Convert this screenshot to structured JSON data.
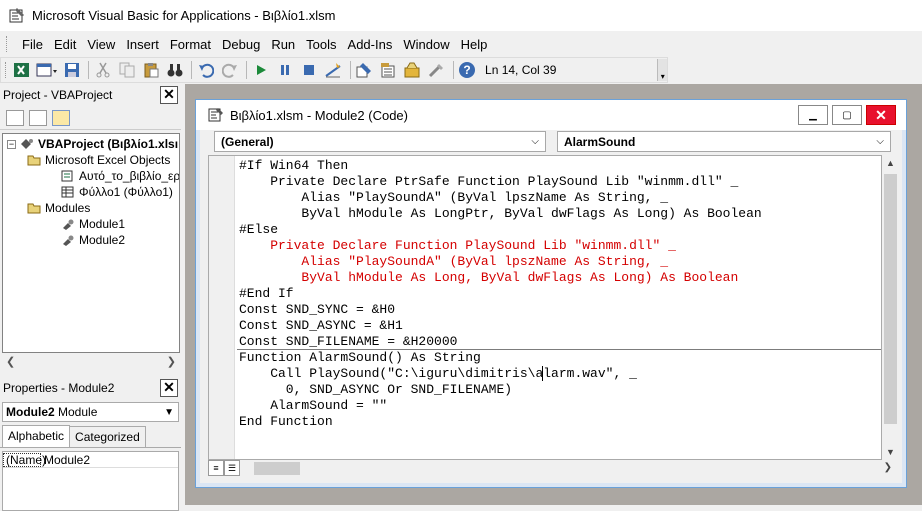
{
  "app": {
    "title": "Microsoft Visual Basic for Applications - Βιβλίο1.xlsm"
  },
  "menu": [
    "File",
    "Edit",
    "View",
    "Insert",
    "Format",
    "Debug",
    "Run",
    "Tools",
    "Add-Ins",
    "Window",
    "Help"
  ],
  "toolbar": {
    "position": "Ln 14, Col 39"
  },
  "project_pane": {
    "title": "Project - VBAProject",
    "tree": {
      "root": "VBAProject (Βιβλίο1.xlsı",
      "folder_objects": "Microsoft Excel Objects",
      "this_workbook": "Αυτό_το_βιβλίο_εργ",
      "sheet1": "Φύλλο1 (Φύλλο1)",
      "folder_modules": "Modules",
      "module1": "Module1",
      "module2": "Module2"
    }
  },
  "properties_pane": {
    "title": "Properties - Module2",
    "object_name": "Module2",
    "object_type": "Module",
    "tabs": [
      "Alphabetic",
      "Categorized"
    ],
    "rows": [
      {
        "key": "(Name)",
        "value": "Module2"
      }
    ]
  },
  "code_window": {
    "title": "Βιβλίο1.xlsm - Module2 (Code)",
    "object_combo": "(General)",
    "proc_combo": "AlarmSound",
    "lines": [
      {
        "text": "#If Win64 Then",
        "color": "black"
      },
      {
        "text": "    Private Declare PtrSafe Function PlaySound Lib \"winmm.dll\" _",
        "color": "black"
      },
      {
        "text": "        Alias \"PlaySoundA\" (ByVal lpszName As String, _",
        "color": "black"
      },
      {
        "text": "        ByVal hModule As LongPtr, ByVal dwFlags As Long) As Boolean",
        "color": "black"
      },
      {
        "text": "#Else",
        "color": "black"
      },
      {
        "text": "    Private Declare Function PlaySound Lib \"winmm.dll\" _",
        "color": "red"
      },
      {
        "text": "        Alias \"PlaySoundA\" (ByVal lpszName As String, _",
        "color": "red"
      },
      {
        "text": "        ByVal hModule As Long, ByVal dwFlags As Long) As Boolean",
        "color": "red"
      },
      {
        "text": "#End If",
        "color": "black"
      },
      {
        "text": "Const SND_SYNC = &H0",
        "color": "black"
      },
      {
        "text": "Const SND_ASYNC = &H1",
        "color": "black"
      },
      {
        "text": "Const SND_FILENAME = &H20000",
        "color": "black"
      },
      {
        "text": "Function AlarmSound() As String",
        "color": "black"
      },
      {
        "text": "    Call PlaySound(\"C:\\iguru\\dimitris\\alarm.wav\", _",
        "color": "black"
      },
      {
        "text": "      0, SND_ASYNC Or SND_FILENAME)",
        "color": "black"
      },
      {
        "text": "    AlarmSound = \"\"",
        "color": "black"
      },
      {
        "text": "End Function",
        "color": "black"
      }
    ]
  },
  "colors": {
    "mdi_background": "#aba7a2",
    "conditional_code": "#d40000",
    "close_button": "#e8112d"
  }
}
